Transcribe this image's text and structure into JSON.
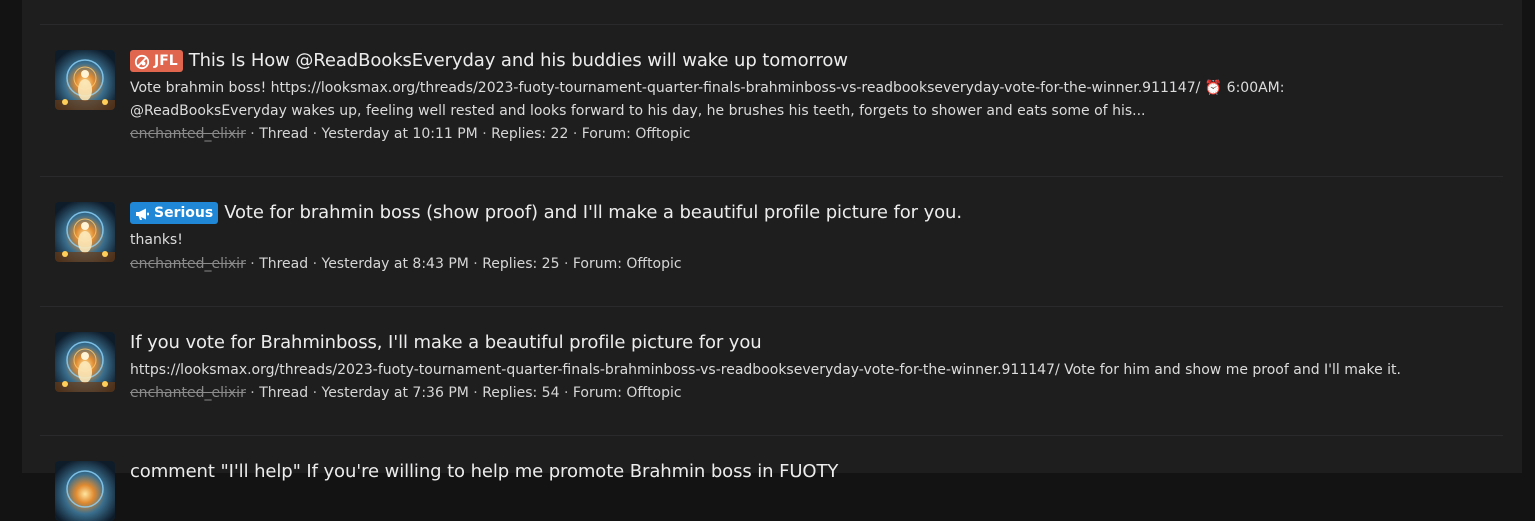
{
  "colors": {
    "page_bg": "#131313",
    "panel_bg": "#1e1e1f",
    "badge_jfl": "#e0664e",
    "badge_serious": "#1f87d6"
  },
  "results": [
    {
      "badge": {
        "label": "JFL",
        "icon": "slash-circle-icon",
        "color": "#e0664e"
      },
      "title": "This Is How @ReadBooksEveryday and his buddies will wake up tomorrow",
      "snippet_line1": "Vote brahmin boss! https://looksmax.org/threads/2023-fuoty-tournament-quarter-finals-brahminboss-vs-readbookseveryday-vote-for-the-winner.911147/ ⏰ 6:00AM:",
      "snippet_line2": "@ReadBooksEveryday wakes up, feeling well rested and looks forward to his day, he brushes his teeth, forgets to shower and eats some of his...",
      "user": "enchanted_elixir",
      "type": "Thread",
      "date": "Yesterday at 10:11 PM",
      "replies": "Replies: 22",
      "forum_prefix": "Forum:",
      "forum": "Offtopic"
    },
    {
      "badge": {
        "label": "Serious",
        "icon": "megaphone-icon",
        "color": "#1f87d6"
      },
      "title": "Vote for brahmin boss (show proof) and I'll make a beautiful profile picture for you.",
      "snippet_line1": "thanks!",
      "snippet_line2": "",
      "user": "enchanted_elixir",
      "type": "Thread",
      "date": "Yesterday at 8:43 PM",
      "replies": "Replies: 25",
      "forum_prefix": "Forum:",
      "forum": "Offtopic"
    },
    {
      "badge": null,
      "title": "If you vote for Brahminboss, I'll make a beautiful profile picture for you",
      "snippet_line1": "https://looksmax.org/threads/2023-fuoty-tournament-quarter-finals-brahminboss-vs-readbookseveryday-vote-for-the-winner.911147/ Vote for him and show me proof and I'll make it.",
      "snippet_line2": "",
      "user": "enchanted_elixir",
      "type": "Thread",
      "date": "Yesterday at 7:36 PM",
      "replies": "Replies: 54",
      "forum_prefix": "Forum:",
      "forum": "Offtopic"
    },
    {
      "title": "comment \"I'll help\" If you're willing to help me promote Brahmin boss in FUOTY"
    }
  ]
}
